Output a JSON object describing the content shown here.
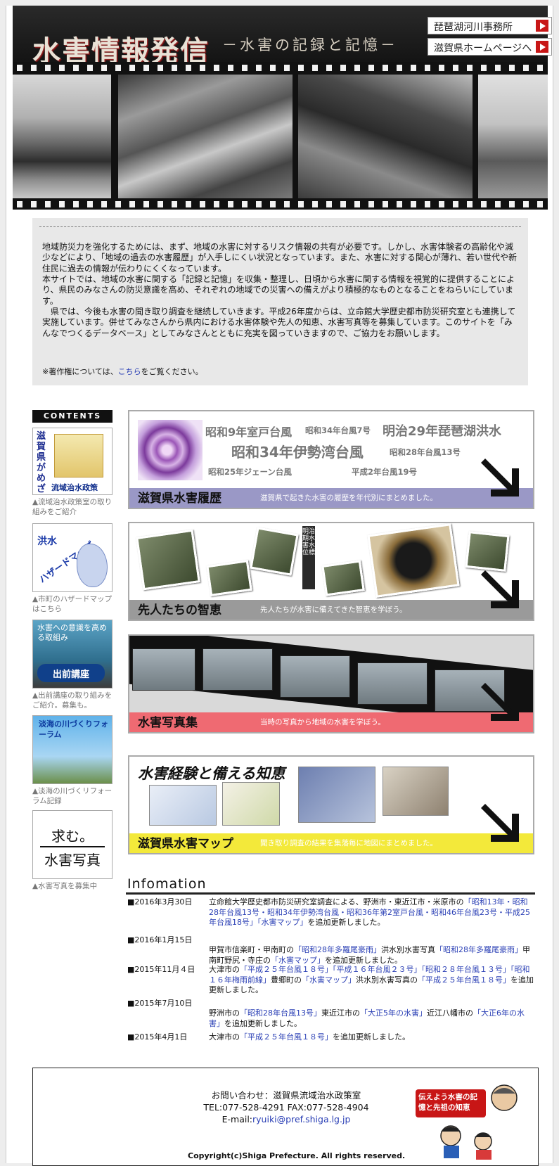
{
  "header": {
    "title": "水害情報発信",
    "subtitle": "－水害の記録と記憶－",
    "links": [
      {
        "label": "琵琶湖河川事務所"
      },
      {
        "label": "滋賀県ホームページへ"
      }
    ]
  },
  "intro": {
    "paragraph1": "地域防災力を強化するためには、まず、地域の水害に対するリスク情報の共有が必要です。しかし、水害体験者の高齢化や減少などにより、「地域の過去の水害履歴」が入手しにくい状況となっています。また、水害に対する関心が薄れ、若い世代や新住民に過去の情報が伝わりにくくなっています。",
    "paragraph2": "本サイトでは、地域の水害に関する「記録と記憶」を収集・整理し、日頃から水害に関する情報を視覚的に提供することにより、県民のみなさんの防災意識を高め、それぞれの地域での災害への備えがより積極的なものとなることをねらいにしています。",
    "paragraph3": "県では、今後も水害の聞き取り調査を継続していきます。平成26年度からは、立命館大学歴史都市防災研究室とも連携して実施しています。併せてみなさんから県内における水害体験や先人の知恵、水害写真等を募集しています。このサイトを「みんなでつくるデータベース」としてみなさんとともに充実を図っていきますので、ご協力をお願いします。",
    "note_prefix": "※著作権については、",
    "note_link": "こちら",
    "note_suffix": "をご覧ください。"
  },
  "sidebar": {
    "contents_label": "CONTENTS",
    "banners": [
      {
        "text_vertical": "滋賀県がめざす",
        "label": "流域治水政策",
        "caption": "▲流域治水政策室の取り組みをご紹介"
      },
      {
        "text1": "洪水",
        "text2": "ハザードマップ",
        "caption": "▲市町のハザードマップはこちら"
      },
      {
        "text1": "水害への意識を高める取組み",
        "badge": "出前講座",
        "caption": "▲出前講座の取り組みをご紹介。募集も。"
      },
      {
        "text1": "淡海の川づくりフォーラム",
        "caption": "▲淡海の川づくリフォーラム記録"
      },
      {
        "text1": "求む。",
        "text2": "水害写真",
        "caption": "▲水害写真を募集中"
      }
    ]
  },
  "main_banners": [
    {
      "title": "滋賀県水害履歴",
      "desc": "滋賀県で起きた水害の履歴を年代別にまとめました。",
      "strip_color": "#9a98c6",
      "typhoons": [
        "昭和9年室戸台風",
        "昭和34年台風7号",
        "明治29年琵琶湖洪水",
        "昭和34年伊勢湾台風",
        "昭和28年台風13号",
        "昭和25年ジェーン台風",
        "平成2年台風19号"
      ]
    },
    {
      "title": "先人たちの智恵",
      "desc": "先人たちが水害に備えてきた智恵を学ぼう。",
      "strip_color": "#9a9a9a",
      "sign": "明治期水害水位標"
    },
    {
      "title": "水害写真集",
      "desc": "当時の写真から地域の水害を学ぼう。",
      "strip_color": "#ef6a72"
    },
    {
      "heading": "水害経験と備える知恵",
      "title": "滋賀県水害マップ",
      "desc": "聞き取り調査の結果を集落毎に地図にまとめました。",
      "strip_color": "#f3e93a"
    }
  ],
  "information": {
    "title": "Infomation",
    "rows": [
      {
        "date": "■2016年3月30日",
        "text_pre": "立命館大学歴史都市防災研究室調査による、野洲市・東近江市・米原市の",
        "links": "「昭和13年・昭和28年台風13号・昭和34年伊勢湾台風・昭和36年第2室戸台風・昭和46年台風23号・平成25年台風18号」「水害マップ」",
        "text_post": "を追加更新しました。"
      },
      {
        "date": "■2016年1月15日",
        "text_pre": "甲賀市信楽町・甲南町の",
        "links": "「昭和28年多羅尾豪雨」",
        "text_mid": "洪水別水害写真",
        "links2": "「昭和28年多羅尾豪雨」",
        "text_mid2": "甲南町野尻・寺庄の",
        "links3": "「水害マップ」",
        "text_post": "を追加更新しました。"
      },
      {
        "date": "■2015年11月４日",
        "text_pre": "大津市の",
        "links": "「平成２５年台風１８号」「平成１６年台風２３号」「昭和２８年台風１３号」「昭和１６年梅雨前線」",
        "text_mid": "豊郷町の",
        "links2": "「水害マップ」",
        "text_mid2": "洪水別水害写真の",
        "links3": "「平成２５年台風１８号」",
        "text_post": "を追加更新しました。"
      },
      {
        "date": "■2015年7月10日",
        "text_pre": "野洲市の",
        "links": "「昭和28年台風13号」",
        "text_mid": "東近江市の",
        "links2": "「大正5年の水害」",
        "text_mid2": "近江八幡市の",
        "links3": "「大正6年の水害」",
        "text_post": "を追加更新しました。"
      },
      {
        "date": "■2015年4月1日",
        "text_pre": "大津市の",
        "links": "「平成２５年台風１８号」",
        "text_post": "を追加更新しました。"
      }
    ]
  },
  "footer": {
    "contact_line1": "お問い合わせ：滋賀県流域治水政策室",
    "contact_line2": "TEL:077-528-4291 FAX:077-528-4904",
    "mail_prefix": "E-mail:",
    "mail": "ryuiki@pref.shiga.lg.jp",
    "copyright": "Copyright(c)Shiga Prefecture. All rights reserved.",
    "mascot_text": "伝えよう水害の記憶と先祖の知恵"
  },
  "colors": {
    "accent_red": "#c81616",
    "link_blue": "#2a3fb5"
  }
}
